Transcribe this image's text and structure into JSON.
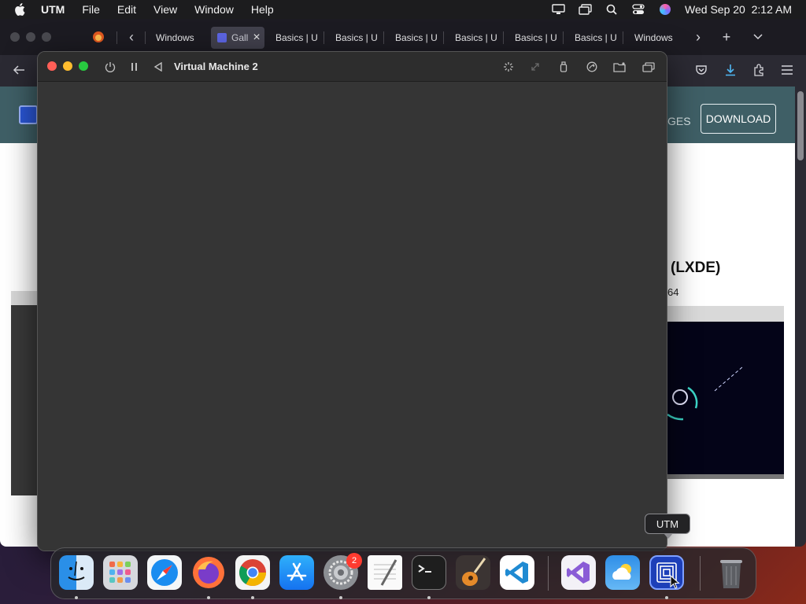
{
  "menubar": {
    "app_name": "UTM",
    "menus": [
      "File",
      "Edit",
      "View",
      "Window",
      "Help"
    ],
    "datetime": "Wed Sep 20  2:12 AM",
    "status_icons": [
      "display-icon",
      "window-stack-icon",
      "search-icon",
      "control-center-icon",
      "siri-icon"
    ]
  },
  "browser": {
    "tabs": [
      {
        "label": "Windows"
      },
      {
        "label": "Gall",
        "active": true
      },
      {
        "label": "Basics | U"
      },
      {
        "label": "Basics | U"
      },
      {
        "label": "Basics | U"
      },
      {
        "label": "Basics | U"
      },
      {
        "label": "Basics | U"
      },
      {
        "label": "Basics | U"
      },
      {
        "label": "Windows"
      }
    ],
    "page": {
      "nav_fragment": "GES",
      "download_label": "DOWNLOAD",
      "gallery_title": "(LXDE)",
      "gallery_subtitle": "64"
    }
  },
  "utm_window": {
    "title": "Virtual Machine 2",
    "toolbar_icons": [
      "power-icon",
      "pause-icon",
      "back-icon",
      "display-settings-icon",
      "resize-icon",
      "usb-icon",
      "share-icon",
      "folder-icon",
      "windows-icon"
    ]
  },
  "dock": {
    "apps": [
      "Finder",
      "Launchpad",
      "Safari",
      "Firefox",
      "Google Chrome",
      "App Store",
      "System Settings",
      "TextEdit",
      "Terminal",
      "GarageBand",
      "Visual Studio Code",
      "Visual Studio",
      "Weather",
      "UTM",
      "Trash"
    ],
    "settings_badge": "2",
    "tooltip": "UTM"
  },
  "colors": {
    "close": "#ff5f57",
    "minimize": "#febc2e",
    "zoom": "#28c840",
    "site_header": "#3f5f66",
    "vm_background": "#353535"
  }
}
